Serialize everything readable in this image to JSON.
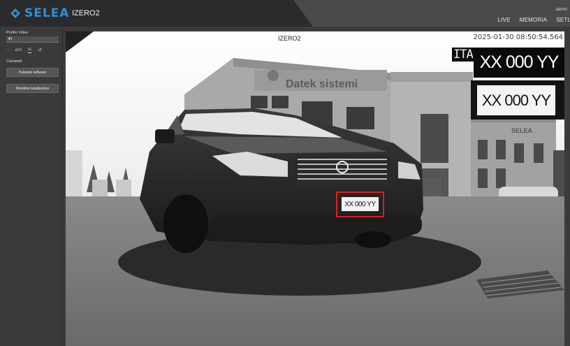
{
  "app": {
    "brand": "SELEA",
    "device_name": "IZERO2",
    "user": "admin",
    "colors": {
      "brand": "#2f8fd6",
      "plate_box": "#d82020",
      "topbar": "#2b2b2b",
      "sidebar": "#3a3a3a"
    }
  },
  "nav": {
    "items": [
      "LIVE",
      "MEMORIA",
      "SETUP"
    ]
  },
  "sidebar": {
    "profile_label": "Profilo Video",
    "profile_value": "#1",
    "zoom_options": [
      "x0.5",
      "x1",
      "x2"
    ],
    "zoom_selected": "x1",
    "commands_label": "Comandi",
    "buttons": [
      "Pulsante software",
      "Modalità installazione"
    ]
  },
  "video": {
    "camera_title": "IZERO2",
    "timestamp": "2025-01-30 08:50:54.564",
    "country_code": "ITA",
    "plate_text": "XX 000 YY",
    "building_sign": "Datek sistemi",
    "building_sign_2": "SELEA"
  }
}
